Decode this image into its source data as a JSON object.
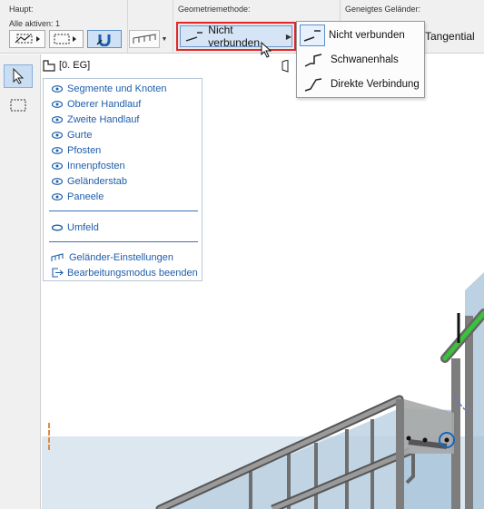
{
  "toolbar": {
    "main_label": "Haupt:",
    "all_active_label": "Alle aktiven: 1",
    "geometry_label": "Geometriemethode:",
    "geometry_value": "Nicht verbunden",
    "inclined_label": "Geneigtes Geländer:",
    "tangential_label": "Tangential"
  },
  "popup": {
    "items": [
      {
        "label": "Nicht verbunden",
        "icon": "not-connected-icon",
        "selected": true
      },
      {
        "label": "Schwanenhals",
        "icon": "gooseneck-icon",
        "selected": false
      },
      {
        "label": "Direkte Verbindung",
        "icon": "direct-connection-icon",
        "selected": false
      }
    ]
  },
  "story": {
    "label": "[0. EG]"
  },
  "panel": {
    "items": [
      "Segmente und Knoten",
      "Oberer Handlauf",
      "Zweite Handlauf",
      "Gurte",
      "Pfosten",
      "Innenpfosten",
      "Geländerstab",
      "Paneele"
    ],
    "environment": "Umfeld",
    "settings": "Geländer-Einstellungen",
    "exit": "Bearbeitungsmodus beenden"
  },
  "colors": {
    "accent": "#1f5eaa",
    "highlight_frame": "#e2262b",
    "selection_fill": "#d5e5f5",
    "handrail_green": "#39c23a",
    "node_blue": "#1565c0"
  }
}
